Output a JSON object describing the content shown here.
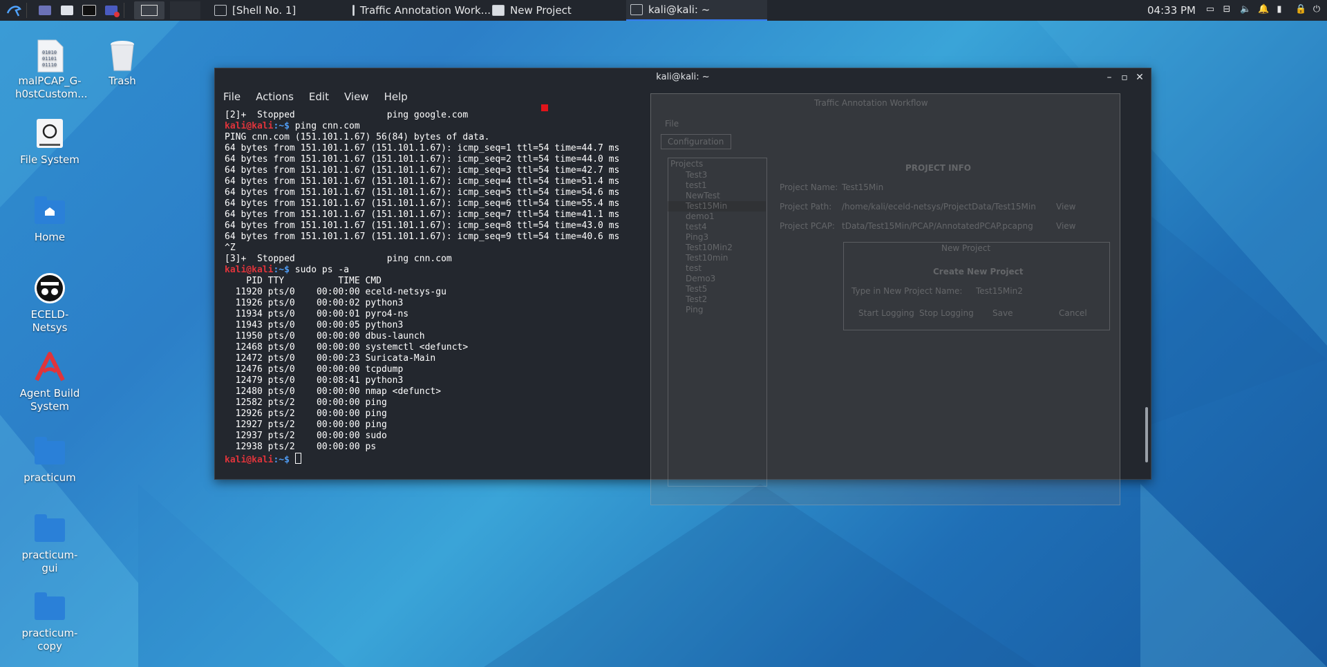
{
  "taskbar": {
    "tasks": [
      {
        "label": "[Shell No. 1]"
      },
      {
        "label": "Traffic Annotation Work..."
      },
      {
        "label": "New Project"
      },
      {
        "label": "kali@kali: ~"
      }
    ],
    "clock": "04:33 PM"
  },
  "desktop": {
    "icons": [
      {
        "label": "malPCAP_G-h0stCustom..."
      },
      {
        "label": "Trash"
      },
      {
        "label": "File System"
      },
      {
        "label": "Home"
      },
      {
        "label": "ECELD-Netsys"
      },
      {
        "label": "Agent Build System"
      },
      {
        "label": "practicum"
      },
      {
        "label": "practicum-gui"
      },
      {
        "label": "practicum-copy"
      }
    ]
  },
  "terminal": {
    "title": "kali@kali: ~",
    "menu": [
      "File",
      "Actions",
      "Edit",
      "View",
      "Help"
    ],
    "prompt_user": "kali@kali",
    "prompt_path": ":~$",
    "lines": [
      "[2]+  Stopped                 ping google.com",
      {
        "cmd": " ping cnn.com"
      },
      "PING cnn.com (151.101.1.67) 56(84) bytes of data.",
      "64 bytes from 151.101.1.67 (151.101.1.67): icmp_seq=1 ttl=54 time=44.7 ms",
      "64 bytes from 151.101.1.67 (151.101.1.67): icmp_seq=2 ttl=54 time=44.0 ms",
      "64 bytes from 151.101.1.67 (151.101.1.67): icmp_seq=3 ttl=54 time=42.7 ms",
      "64 bytes from 151.101.1.67 (151.101.1.67): icmp_seq=4 ttl=54 time=51.4 ms",
      "64 bytes from 151.101.1.67 (151.101.1.67): icmp_seq=5 ttl=54 time=54.6 ms",
      "64 bytes from 151.101.1.67 (151.101.1.67): icmp_seq=6 ttl=54 time=55.4 ms",
      "64 bytes from 151.101.1.67 (151.101.1.67): icmp_seq=7 ttl=54 time=41.1 ms",
      "64 bytes from 151.101.1.67 (151.101.1.67): icmp_seq=8 ttl=54 time=43.0 ms",
      "64 bytes from 151.101.1.67 (151.101.1.67): icmp_seq=9 ttl=54 time=40.6 ms",
      "^Z",
      "[3]+  Stopped                 ping cnn.com",
      {
        "cmd": " sudo ps -a"
      },
      "    PID TTY          TIME CMD",
      "  11920 pts/0    00:00:00 eceld-netsys-gu",
      "  11926 pts/0    00:00:02 python3",
      "  11934 pts/0    00:00:01 pyro4-ns",
      "  11943 pts/0    00:00:05 python3",
      "  11950 pts/0    00:00:00 dbus-launch",
      "  12468 pts/0    00:00:00 systemctl <defunct>",
      "  12472 pts/0    00:00:23 Suricata-Main",
      "  12476 pts/0    00:00:00 tcpdump",
      "  12479 pts/0    00:08:41 python3",
      "  12480 pts/0    00:00:00 nmap <defunct>",
      "  12582 pts/2    00:00:00 ping",
      "  12926 pts/2    00:00:00 ping",
      "  12927 pts/2    00:00:00 ping",
      "  12937 pts/2    00:00:00 sudo",
      "  12938 pts/2    00:00:00 ps",
      {
        "cmd": " "
      }
    ]
  },
  "ghost": {
    "title": "Traffic Annotation Workflow",
    "menu_file": "File",
    "config_tab": "Configuration",
    "projects_header": "Projects",
    "projects": [
      "Test3",
      "test1",
      "NewTest",
      "Test15Min",
      "demo1",
      "test4",
      "Ping3",
      "Test10Min2",
      "Test10min",
      "test",
      "Demo3",
      "Test5",
      "Test2",
      "Ping"
    ],
    "info_header": "PROJECT INFO",
    "name_label": "Project Name:",
    "name_value": "Test15Min",
    "path_label": "Project Path:",
    "path_value": "/home/kali/eceld-netsys/ProjectData/Test15Min",
    "pcap_label": "Project PCAP:",
    "pcap_value": "tData/Test15Min/PCAP/AnnotatedPCAP.pcapng",
    "view_label": "View",
    "dialog_title": "New Project",
    "dialog_heading": "Create New Project",
    "dialog_prompt": "Type in New Project Name:",
    "dialog_value": "Test15Min2",
    "btn_start": "Start Logging",
    "btn_stop": "Stop Logging",
    "btn_save": "Save",
    "btn_cancel": "Cancel"
  }
}
